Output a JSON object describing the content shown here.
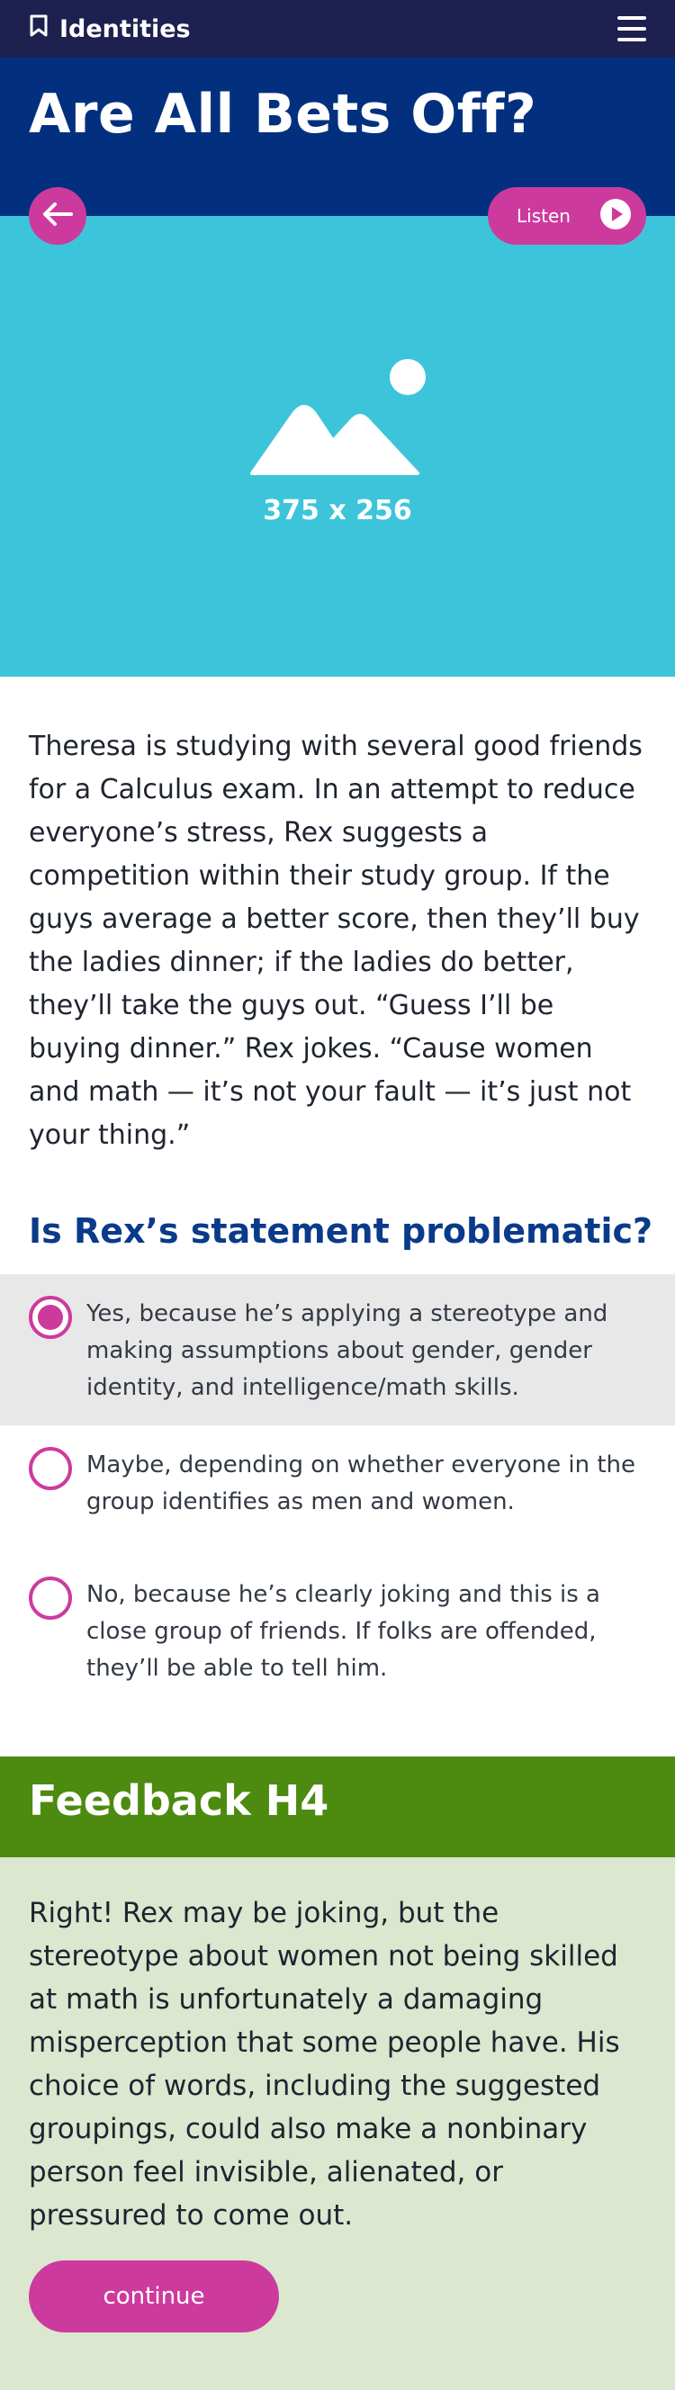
{
  "topbar": {
    "brand_label": "Identities",
    "brand_icon": "bookmark-icon",
    "menu_icon": "hamburger-menu-icon"
  },
  "page": {
    "title": "Are All Bets Off?"
  },
  "hero": {
    "back_icon": "arrow-left-icon",
    "listen_label": "Listen",
    "listen_icon": "play-icon",
    "image_icon": "image-placeholder-icon",
    "image_label": "375 x 256",
    "background_color": "#3cc5da"
  },
  "story": {
    "text": "Theresa is studying with several good friends for a Calculus exam. In an attempt to reduce everyone’s stress, Rex suggests a competition within their study group. If the guys average a better score, then they’ll buy the ladies dinner; if the ladies do better, they’ll take the guys out. “Guess I’ll be buying dinner.” Rex jokes. “Cause women and math — it’s not your fault — it’s just not your thing.”"
  },
  "question": {
    "text": "Is Rex’s statement problematic?",
    "options": [
      {
        "label": "Yes, because he’s applying a stereotype and making assumptions about gender, gender identity, and intelligence/math skills.",
        "selected": true
      },
      {
        "label": "Maybe, depending on whether everyone in the group identifies as men and women.",
        "selected": false
      },
      {
        "label": "No, because he’s clearly joking and this is a close group of friends. If folks are offended, they’ll be able to tell him.",
        "selected": false
      }
    ]
  },
  "feedback": {
    "heading": "Feedback H4",
    "text": "Right! Rex may be joking, but the stereotype about women not being skilled at math is unfortunately a damaging misperception that some people have. His choice of words, including the suggested groupings, could also make a nonbinary person feel invisible, alienated, or pressured to come out.",
    "continue_label": "continue"
  },
  "colors": {
    "topbar": "#1e2050",
    "title_band": "#03307e",
    "accent": "#cd3a9e",
    "question_heading": "#0a3a8a",
    "feedback_head": "#4c8a10",
    "feedback_body": "#dbe7cf"
  }
}
